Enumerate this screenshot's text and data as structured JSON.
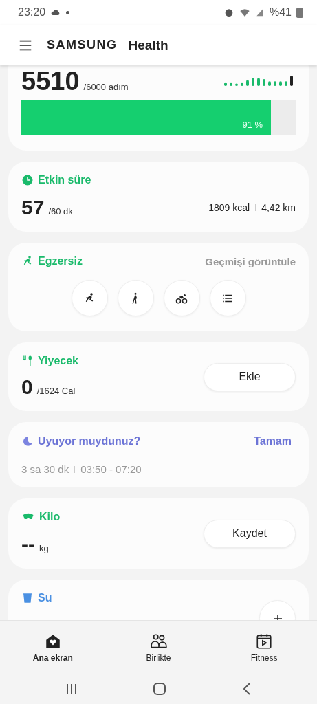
{
  "status_bar": {
    "time": "23:20",
    "battery": "%41"
  },
  "header": {
    "brand": "SAMSUNG",
    "product": "Health"
  },
  "cards": [
    {
      "kind": "steps",
      "value": "5510",
      "target": "/6000 adım",
      "level": 0.91,
      "percent": "91 %"
    },
    {
      "kind": "active",
      "title": "Etkin süre",
      "value": "57",
      "target": "/60 dk",
      "stats": [
        "1809 kcal",
        "4,42 km"
      ]
    },
    {
      "kind": "exercise",
      "title": "Egzersiz",
      "link": "Geçmişi görüntüle"
    },
    {
      "kind": "food",
      "title": "Yiyecek",
      "value": "0",
      "target": "/1624 Cal",
      "button": "Ekle"
    },
    {
      "kind": "sleep",
      "title": "Uyuyor muydunuz?",
      "action": "Tamam",
      "duration": "3 sa 30 dk",
      "range": "03:50 - 07:20"
    },
    {
      "kind": "weight",
      "title": "Kilo",
      "value": "--",
      "unit": "kg",
      "button": "Kaydet"
    },
    {
      "kind": "water",
      "title": "Su"
    }
  ],
  "bottom_nav": [
    {
      "label": "Ana ekran",
      "selected": true
    },
    {
      "label": "Birlikte",
      "selected": false
    },
    {
      "label": "Fitness",
      "selected": false
    }
  ]
}
